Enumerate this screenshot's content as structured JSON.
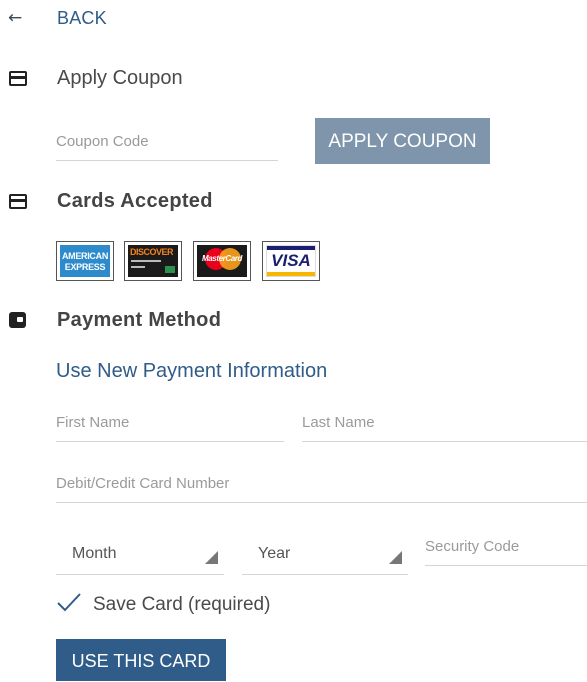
{
  "back": {
    "icon": "arrow-left-icon",
    "label": "BACK"
  },
  "coupon": {
    "icon": "credit-card-icon",
    "title": "Apply Coupon",
    "input_placeholder": "Coupon Code",
    "input_value": "",
    "button_label": "APPLY COUPON"
  },
  "cards_accepted": {
    "icon": "credit-card-icon",
    "title": "Cards Accepted",
    "logos": [
      {
        "name": "American Express",
        "text_top": "AMERICAN",
        "text_bottom": "EXPRESS"
      },
      {
        "name": "Discover",
        "text": "DISCOVER"
      },
      {
        "name": "MasterCard",
        "text": "MasterCard"
      },
      {
        "name": "Visa",
        "text": "VISA"
      }
    ]
  },
  "payment": {
    "icon": "wallet-icon",
    "title": "Payment Method",
    "subtitle": "Use New Payment Information",
    "first_name_placeholder": "First Name",
    "last_name_placeholder": "Last Name",
    "card_number_placeholder": "Debit/Credit Card Number",
    "month_label": "Month",
    "year_label": "Year",
    "security_code_placeholder": "Security Code",
    "save_card_label": "Save Card (required)",
    "save_card_checked": true,
    "submit_label": "USE THIS CARD"
  },
  "colors": {
    "link": "#2f5c88",
    "coupon_button": "#7e95ab",
    "submit_button": "#2f5c88",
    "amex": "#2d8bcc",
    "discover_orange": "#f58220",
    "mastercard_red": "#eb001b",
    "mastercard_yellow": "#f79e1b",
    "visa_blue": "#1a1f71",
    "visa_gold": "#f7b600"
  }
}
